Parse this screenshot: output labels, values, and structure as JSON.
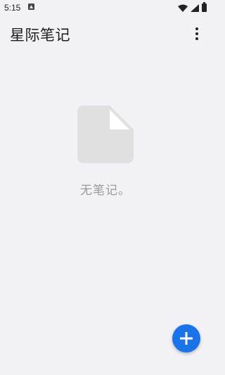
{
  "status_bar": {
    "time": "5:15"
  },
  "app_bar": {
    "title": "星际笔记"
  },
  "empty_state": {
    "message": "无笔记。"
  },
  "colors": {
    "background": "#f2f1f6",
    "fab": "#1a73e8",
    "empty_icon": "#e0e0e0",
    "empty_text": "#9a9a9a"
  },
  "icons": {
    "overflow": "more-vert-icon",
    "empty": "document-icon",
    "fab": "plus-icon"
  }
}
